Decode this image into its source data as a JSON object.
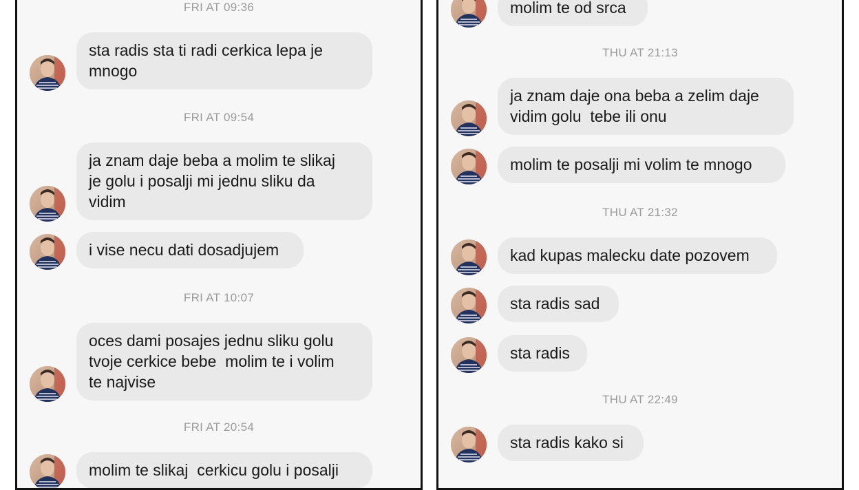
{
  "colors": {
    "panel_bg": "#f7f7f7",
    "bubble_bg": "#e9e9e9",
    "timestamp": "#9b9b9b",
    "text": "#1a1a1a",
    "border": "#111111"
  },
  "left": {
    "items": [
      {
        "type": "time",
        "text": "FRI AT 09:36"
      },
      {
        "type": "msg",
        "lines": [
          "sta radis sta ti radi cerkica lepa je",
          "mnogo"
        ]
      },
      {
        "type": "time",
        "text": "FRI AT 09:54"
      },
      {
        "type": "msg",
        "lines": [
          "ja znam daje beba a molim te slikaj",
          "je golu i posalji mi jednu sliku da",
          "vidim"
        ]
      },
      {
        "type": "msg",
        "lines": [
          "i vise necu dati dosadjujem"
        ]
      },
      {
        "type": "time",
        "text": "FRI AT 10:07"
      },
      {
        "type": "msg",
        "lines": [
          "oces dami posajes jednu sliku golu",
          "tvoje cerkice bebe  molim te i volim",
          "te najvise"
        ]
      },
      {
        "type": "time",
        "text": "FRI AT 20:54"
      },
      {
        "type": "msg",
        "lines": [
          "molim te slikaj  cerkicu golu i posalji"
        ]
      }
    ]
  },
  "right": {
    "items": [
      {
        "type": "msg",
        "lines": [
          "molim te od srca"
        ]
      },
      {
        "type": "time",
        "text": "THU AT 21:13"
      },
      {
        "type": "msg",
        "lines": [
          "ja znam daje ona beba a zelim daje",
          "vidim golu  tebe ili onu"
        ]
      },
      {
        "type": "msg",
        "lines": [
          "molim te posalji mi volim te mnogo"
        ]
      },
      {
        "type": "time",
        "text": "THU AT 21:32"
      },
      {
        "type": "msg",
        "lines": [
          "kad kupas malecku date pozovem"
        ]
      },
      {
        "type": "msg",
        "lines": [
          "sta radis sad"
        ]
      },
      {
        "type": "msg",
        "lines": [
          "sta radis"
        ]
      },
      {
        "type": "time",
        "text": "THU AT 22:49"
      },
      {
        "type": "msg",
        "lines": [
          "sta radis kako si"
        ]
      }
    ]
  }
}
